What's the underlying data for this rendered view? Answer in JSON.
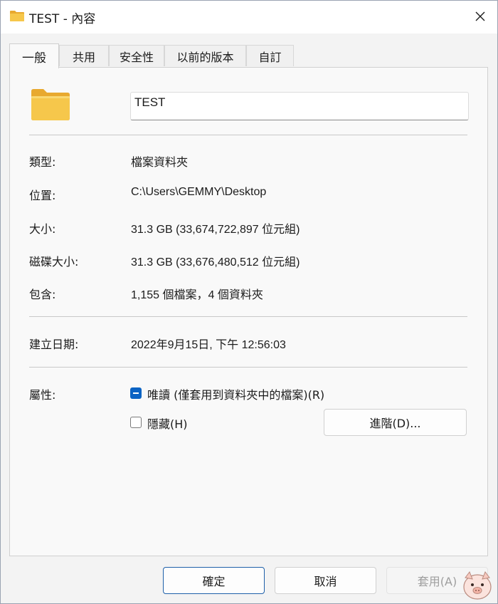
{
  "window": {
    "title": "TEST - 內容"
  },
  "tabs": [
    {
      "label": "一般"
    },
    {
      "label": "共用"
    },
    {
      "label": "安全性"
    },
    {
      "label": "以前的版本"
    },
    {
      "label": "自訂"
    }
  ],
  "general": {
    "name_value": "TEST",
    "rows": [
      {
        "label": "類型:",
        "value": "檔案資料夾"
      },
      {
        "label": "位置:",
        "value": "C:\\Users\\GEMMY\\Desktop"
      },
      {
        "label": "大小:",
        "value": "31.3 GB (33,674,722,897 位元組)"
      },
      {
        "label": "磁碟大小:",
        "value": "31.3 GB (33,676,480,512 位元組)"
      },
      {
        "label": "包含:",
        "value": "1,155 個檔案，4 個資料夾"
      }
    ],
    "created": {
      "label": "建立日期:",
      "value": "2022年9月15日, 下午 12:56:03"
    },
    "attributes": {
      "label": "屬性:",
      "readonly_label": "唯讀 (僅套用到資料夾中的檔案)(R)",
      "readonly_state": "indeterminate",
      "hidden_label": "隱藏(H)",
      "hidden_checked": false,
      "advanced_label": "進階(D)..."
    }
  },
  "buttons": {
    "ok": "確定",
    "cancel": "取消",
    "apply": "套用(A)"
  },
  "colors": {
    "accent": "#0b63c4",
    "folder": "#f6c74b",
    "folder_dark": "#e8a92f"
  },
  "icons": {
    "title": "folder-icon",
    "close": "close-icon",
    "large": "folder-large-icon",
    "watermark": "pig-mascot-watermark"
  }
}
